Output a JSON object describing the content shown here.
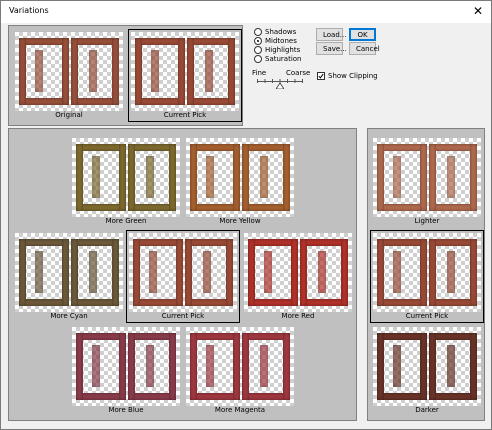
{
  "window": {
    "title": "Variations",
    "close_glyph": "✕"
  },
  "preview": {
    "original": "Original",
    "current": "Current Pick"
  },
  "adjust": {
    "options": [
      {
        "label": "Shadows",
        "checked": false
      },
      {
        "label": "Midtones",
        "checked": true
      },
      {
        "label": "Highlights",
        "checked": false
      },
      {
        "label": "Saturation",
        "checked": false
      }
    ]
  },
  "slider": {
    "fine_label": "Fine",
    "coarse_label": "Coarse",
    "level": 0.5
  },
  "buttons": {
    "load": "Load...",
    "ok": "OK",
    "save": "Save...",
    "cancel": "Cancel"
  },
  "clipping": {
    "label": "Show Clipping",
    "checked": true
  },
  "hue": {
    "more_green": "More Green",
    "more_yellow": "More Yellow",
    "more_cyan": "More Cyan",
    "current": "Current Pick",
    "more_red": "More Red",
    "more_blue": "More Blue",
    "more_magenta": "More Magenta"
  },
  "brightness": {
    "lighter": "Lighter",
    "current": "Current Pick",
    "darker": "Darker"
  },
  "colors": {
    "original": "#98503a",
    "current": "#9a4a36",
    "more_green": "#7e6a2f",
    "more_yellow": "#a6602f",
    "more_cyan": "#6c5a3a",
    "more_red": "#b2322a",
    "more_blue": "#8a3c4a",
    "more_magenta": "#a03840",
    "lighter": "#b06a4e",
    "darker": "#6a3428",
    "dialog_bg": "#f0f0f0",
    "panel_bg": "#c0c0c0",
    "accent": "#0078d7"
  },
  "icons": {
    "close": "close-icon",
    "slider": "slider-thumb-icon",
    "check": "checkmark-icon"
  }
}
